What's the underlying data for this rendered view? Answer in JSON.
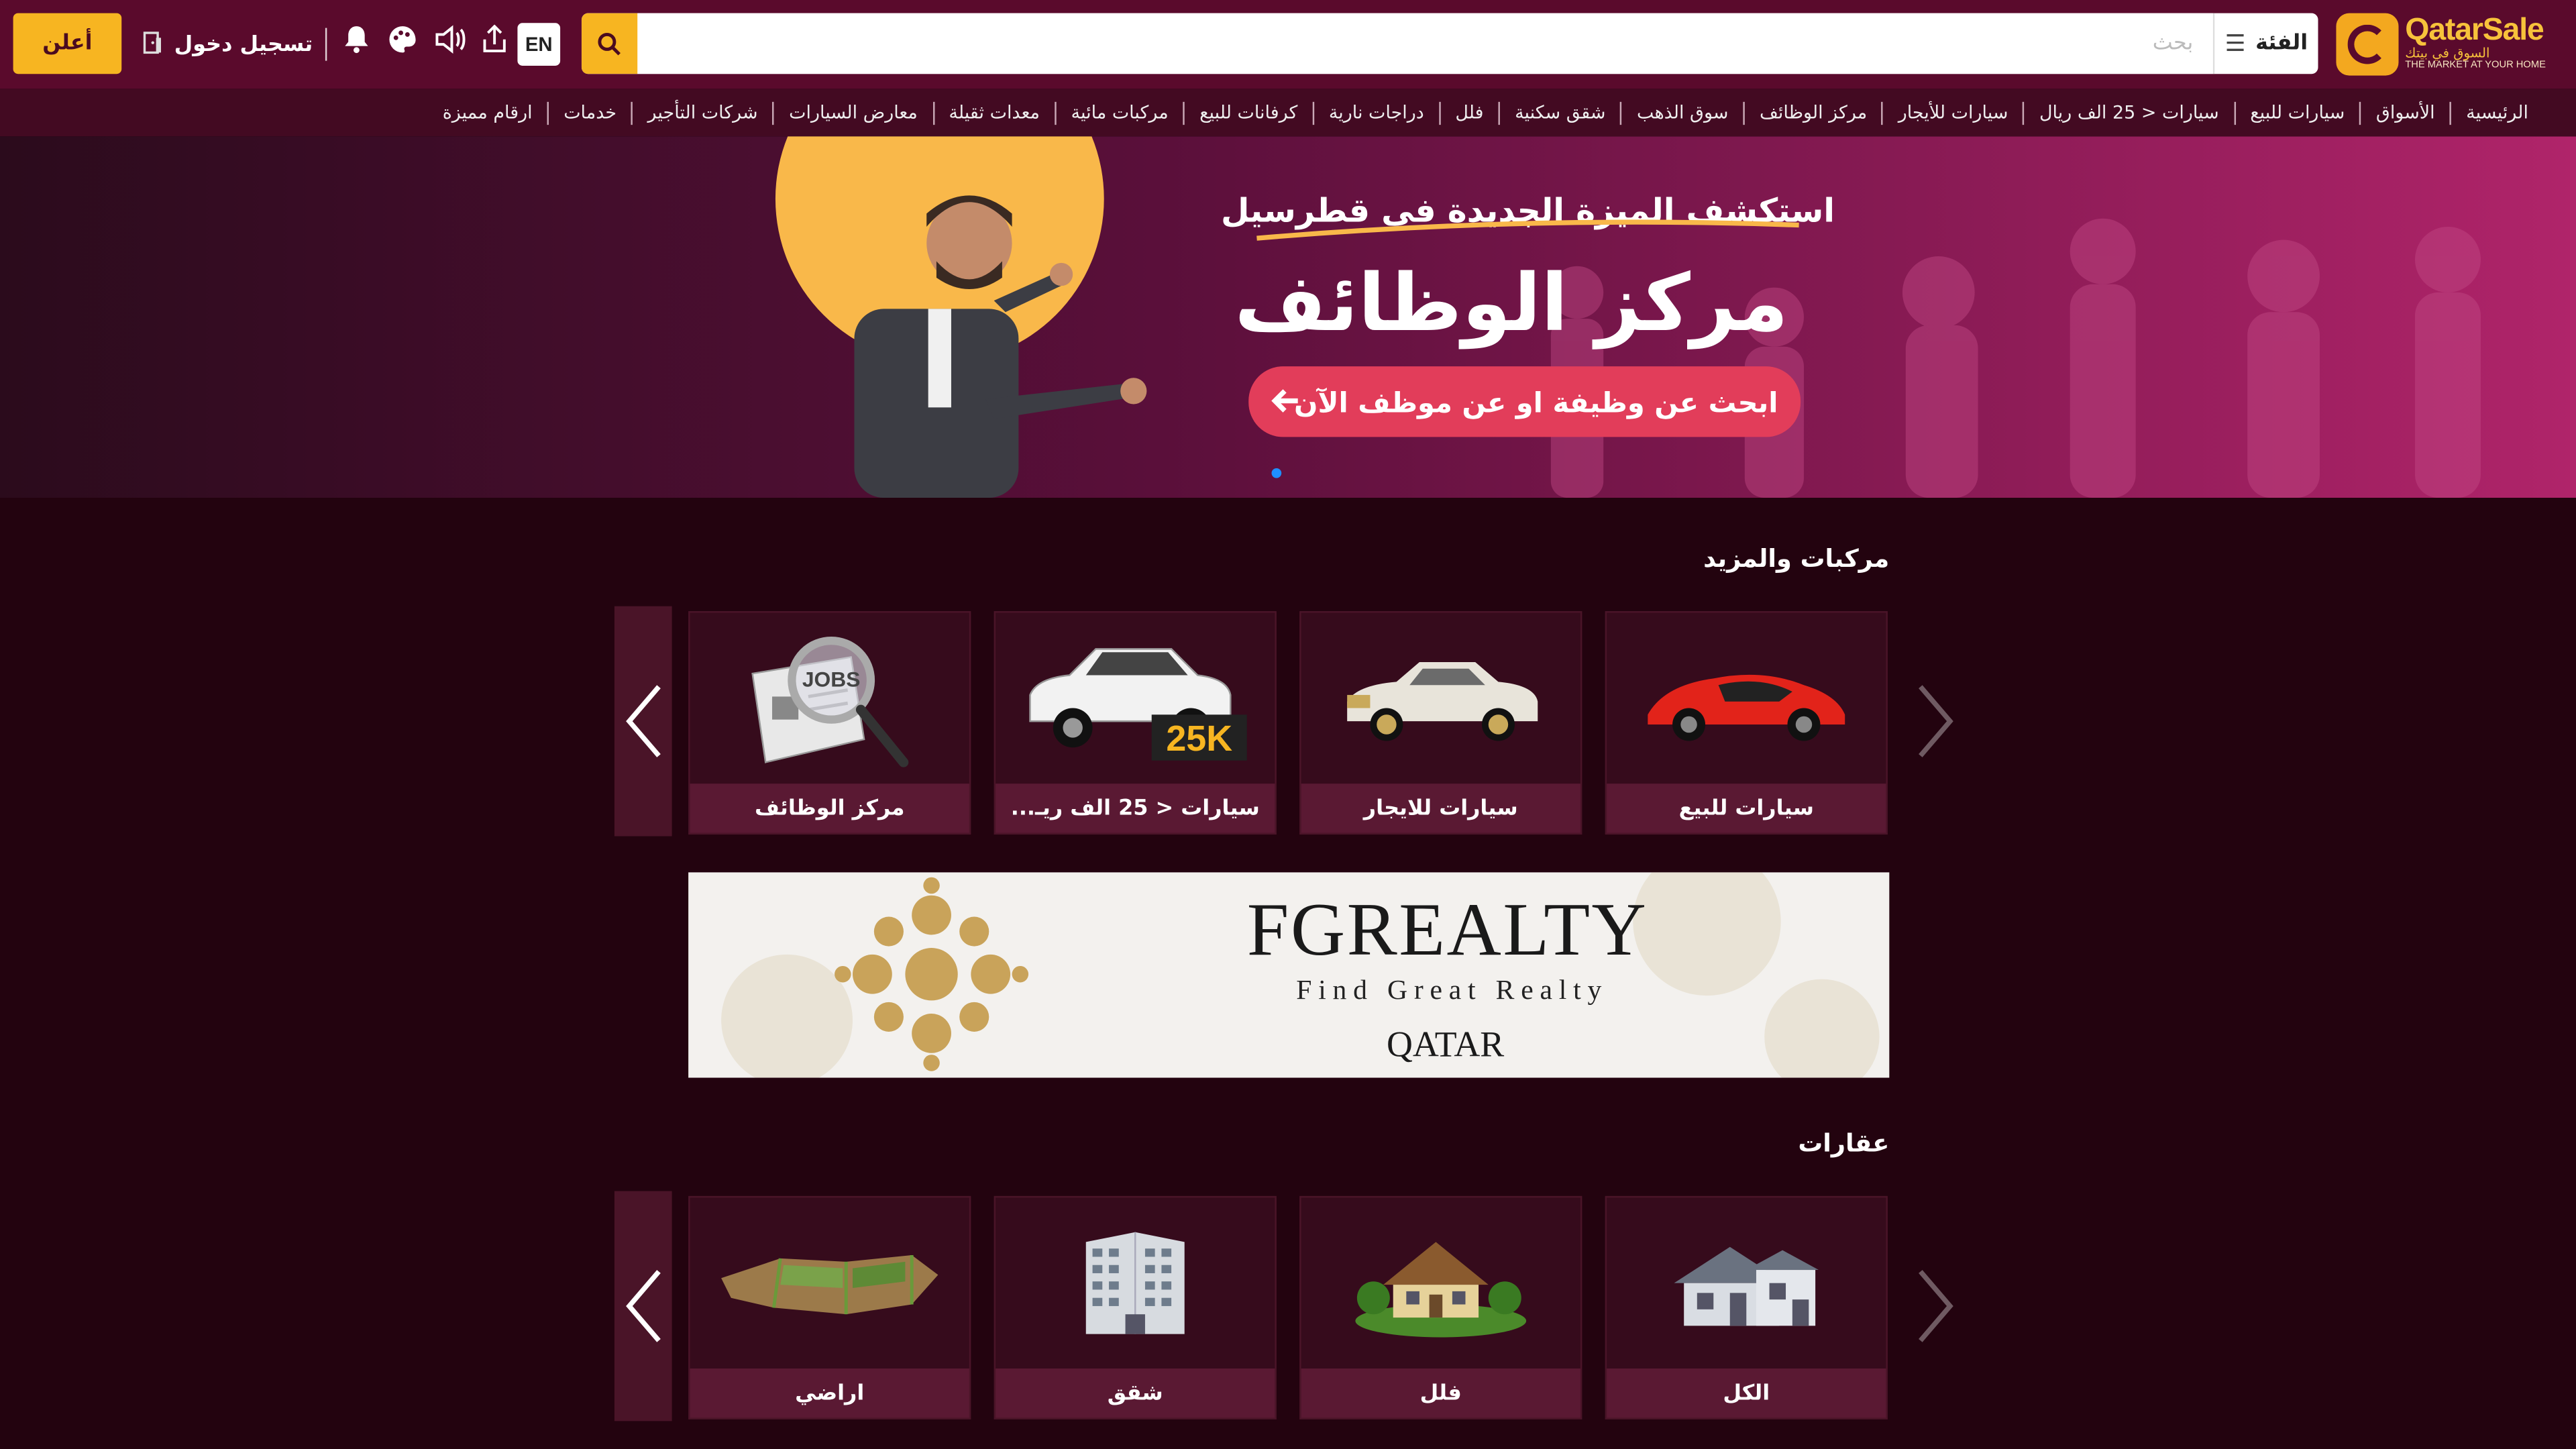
{
  "header": {
    "logo_name": "QatarSale",
    "logo_tagline_ar": "السوق في بيتك",
    "logo_tagline_en": "THE MARKET AT YOUR HOME",
    "category_label": "الفئة",
    "search_placeholder": "بحث",
    "lang_button": "EN",
    "login_label": "تسجيل دخول",
    "post_ad_label": "أعلن"
  },
  "nav": {
    "items": [
      "الرئيسية",
      "الأسواق",
      "سيارات للبيع",
      "سيارات < 25 الف ريال",
      "سيارات للأيجار",
      "مركز الوظائف",
      "سوق الذهب",
      "شقق سكنية",
      "فلل",
      "دراجات نارية",
      "كرفانات للبيع",
      "مركبات مائية",
      "معدات ثقيلة",
      "معارض السيارات",
      "شركات التأجير",
      "خدمات",
      "ارقام مميزة"
    ]
  },
  "hero": {
    "line1": "استكشف الميزة الجديدة في قطرسيل",
    "line2": "مركز الوظائف",
    "cta": "ابحث عن وظيفة او عن موظف الآن"
  },
  "vehicles": {
    "title": "مركبات والمزيد",
    "cards": [
      {
        "label": "سيارات للبيع",
        "icon": "red-sports-car-image"
      },
      {
        "label": "سيارات للايجار",
        "icon": "luxury-car-image"
      },
      {
        "label": "سيارات < 25 الف ريـ...",
        "icon": "suv-25k-image",
        "badge": "25K"
      },
      {
        "label": "مركز الوظائف",
        "icon": "jobs-newspaper-image",
        "badge": "JOBS"
      }
    ]
  },
  "ad": {
    "brand": "FGREALTY",
    "tagline": "Find Great Realty",
    "country": "QATAR"
  },
  "realestate": {
    "title": "عقارات",
    "cards": [
      {
        "label": "الكل",
        "icon": "house-image"
      },
      {
        "label": "فلل",
        "icon": "villa-image"
      },
      {
        "label": "شقق",
        "icon": "apartment-building-image"
      },
      {
        "label": "اراضي",
        "icon": "land-plot-image"
      }
    ]
  },
  "colors": {
    "background": "#23030f",
    "header": "#5a0a2c",
    "accent": "#f7b521",
    "card_label": "#5a1933"
  }
}
